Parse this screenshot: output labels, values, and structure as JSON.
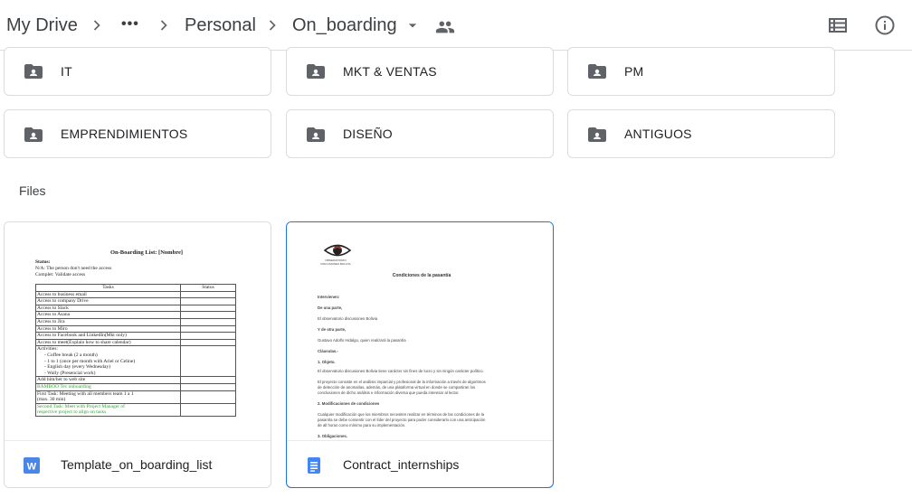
{
  "breadcrumb": {
    "root": "My Drive",
    "ellipsis": "•••",
    "parent": "Personal",
    "current": "On_boarding"
  },
  "header_icons": {
    "dropdown": "caret-down-icon",
    "shared": "people-icon",
    "list_view": "list-view-icon",
    "info": "info-icon"
  },
  "folders": [
    {
      "name": "IT"
    },
    {
      "name": "MKT & VENTAS"
    },
    {
      "name": "PM"
    },
    {
      "name": "EMPRENDIMIENTOS"
    },
    {
      "name": "DISEÑO"
    },
    {
      "name": "ANTIGUOS"
    }
  ],
  "files_label": "Files",
  "files": [
    {
      "name": "Template_on_boarding_list",
      "type_icon": "word-icon",
      "selected": false,
      "preview": {
        "title": "On-Boarding List: [Nombre]",
        "status_label": "Status:",
        "status_lines": [
          "N/A: The person don't need the access",
          "Complet: Validate access"
        ],
        "table_headers": [
          "Tasks",
          "Status"
        ],
        "rows": [
          "Access to business email",
          "Access to company Drive",
          "Access to Slack",
          "Access to Asana",
          "Access to Jira",
          "Access to Miro",
          "Access to Facebook and LinkedIn(Mkt only)",
          "Access to meet(Explain how to share calendar)",
          "Activities:",
          "  -  Coffee break (2 a month)",
          "  -  1 to 1 (once per month with Ariel or Celine)",
          "  -  English day (every Wednesday)",
          "  -  Wally (Presencial work)",
          "Add him/her to web site"
        ],
        "green_rows": [
          "BAMBOO Tec onboarding"
        ],
        "rows_after": [
          "First Task: Meeting with all members team 1 a 1",
          "(max. 30 min)"
        ],
        "green_rows_after": [
          "Second Task: Meet with Project Manager of",
          "respective project to align on tasks"
        ]
      }
    },
    {
      "name": "Contract_internships",
      "type_icon": "google-doc-icon",
      "selected": true,
      "preview": {
        "logo_caption": "OBSERVATORIO DISCUSIONES BOLIVIA",
        "title": "Condiciones de la pasantía",
        "lines": [
          "Intervienen:",
          "De una parte,",
          "El observatorio discusiones Bolivia",
          "Y de otra parte,",
          "Gustavo Adolfo Hidalgo, quien realizará la pasantía",
          "Cláusulas.-",
          "1. Objeto.",
          "El observatorio discusiones Bolivia tiene carácter sin fines de lucro y sin ningún carácter político.",
          "El proyecto consiste en el análisis imparcial y profesional de la información a través de algoritmos",
          "de detección de anomalías, además, de una plataforma virtual en donde se compartiran los",
          "conclusiones de dicho análisis e información diversa que pueda interesar al lector.",
          "2. Modificaciones de condiciones",
          "Cualquier modificación que los miembros necesiten realizar en términos de las condiciones de la",
          "pasantía se debe consentir con el líder del proyecto para poder considerarlo con una anticipación",
          "de all horas como mínimo para su implementación.",
          "3. Obligaciones."
        ]
      }
    }
  ]
}
